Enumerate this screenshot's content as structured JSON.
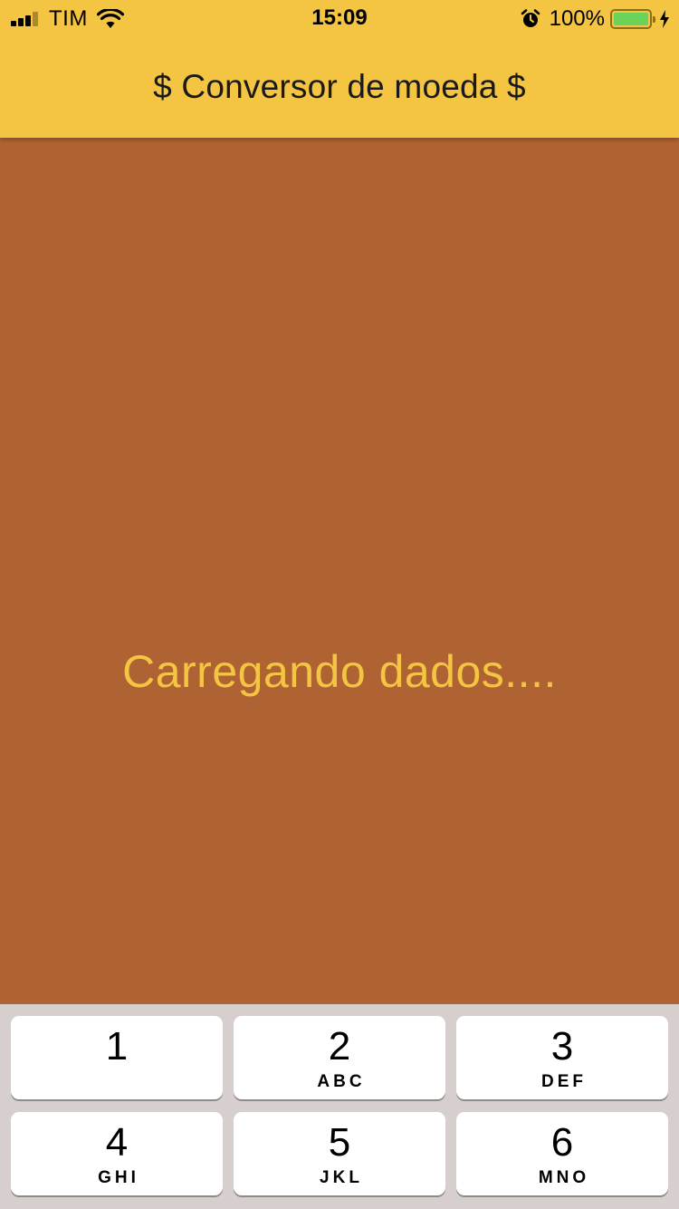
{
  "colors": {
    "header_bg": "#f4c443",
    "body_bg": "#b06332",
    "loading_text": "#f4c443",
    "keypad_bg": "#d6cfcd",
    "key_bg": "#ffffff",
    "battery_fill": "#6ad45a"
  },
  "status_bar": {
    "carrier": "TIM",
    "time": "15:09",
    "battery_percent": "100%",
    "battery_level": 1.0,
    "signal_bars_active": 3,
    "signal_bars_total": 4,
    "icons": [
      "signal-icon",
      "wifi-icon",
      "alarm-icon",
      "battery-icon",
      "charging-bolt-icon"
    ]
  },
  "app_bar": {
    "title": "$ Conversor de moeda $"
  },
  "main": {
    "loading_text": "Carregando dados...."
  },
  "keypad": {
    "keys": [
      {
        "digit": "1",
        "letters": ""
      },
      {
        "digit": "2",
        "letters": "ABC"
      },
      {
        "digit": "3",
        "letters": "DEF"
      },
      {
        "digit": "4",
        "letters": "GHI"
      },
      {
        "digit": "5",
        "letters": "JKL"
      },
      {
        "digit": "6",
        "letters": "MNO"
      }
    ]
  }
}
